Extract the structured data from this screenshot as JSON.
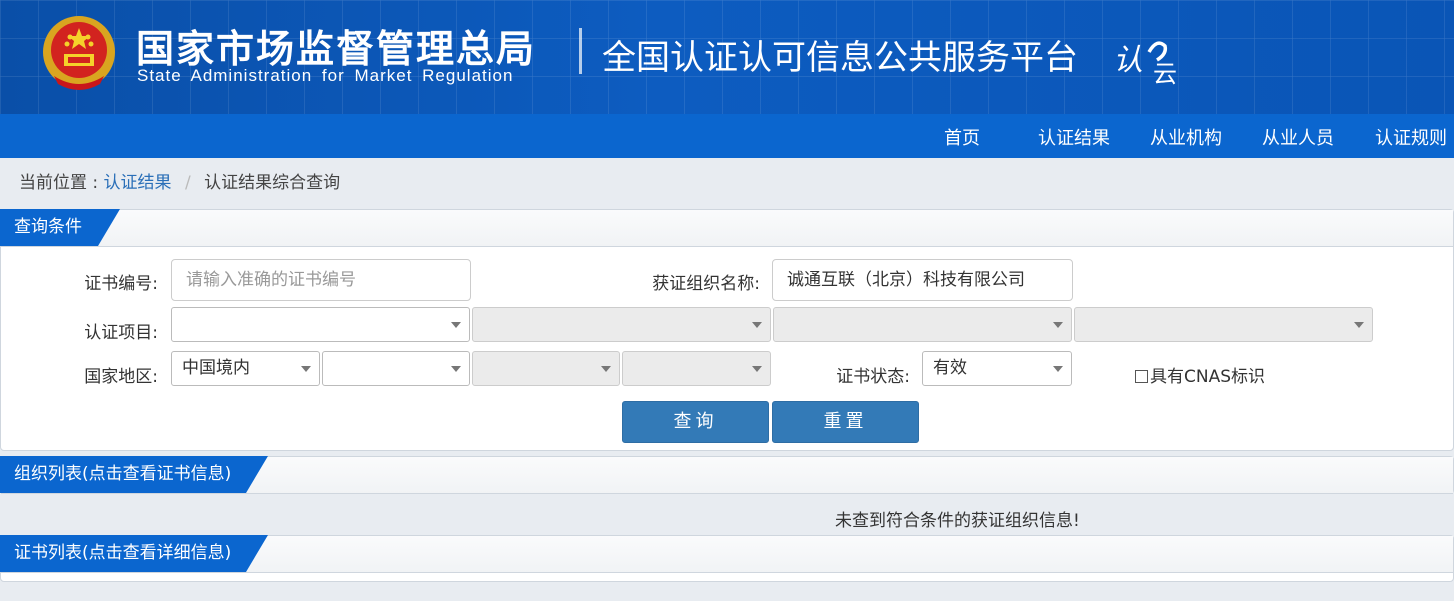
{
  "header": {
    "org_cn": "国家市场监督管理总局",
    "org_en": "State Administration for Market Regulation",
    "platform_title": "全国认证认可信息公共服务平台",
    "logo_text": "认云"
  },
  "nav": {
    "items": [
      "首页",
      "认证结果",
      "从业机构",
      "从业人员",
      "认证规则"
    ]
  },
  "breadcrumb": {
    "prefix": "当前位置 :",
    "link": "认证结果",
    "separator": "/",
    "current": "认证结果综合查询"
  },
  "query_panel": {
    "title": "查询条件",
    "cert_no_label": "证书编号:",
    "cert_no_placeholder": "请输入准确的证书编号",
    "org_name_label": "获证组织名称:",
    "org_name_value": "诚通互联（北京）科技有限公司",
    "project_label": "认证项目:",
    "region_label": "国家地区:",
    "region_value": "中国境内",
    "status_label": "证书状态:",
    "status_value": "有效",
    "cnas_label": "具有CNAS标识",
    "query_button": "查询",
    "reset_button": "重置"
  },
  "org_list": {
    "title": "组织列表(点击查看证书信息)",
    "empty_message": "未查到符合条件的获证组织信息!"
  },
  "cert_list": {
    "title": "证书列表(点击查看详细信息)"
  },
  "colors": {
    "header_bg": "#0a4fa8",
    "nav_bg": "#0b66cf",
    "button_bg": "#337ab7",
    "link": "#2a6fb8"
  }
}
